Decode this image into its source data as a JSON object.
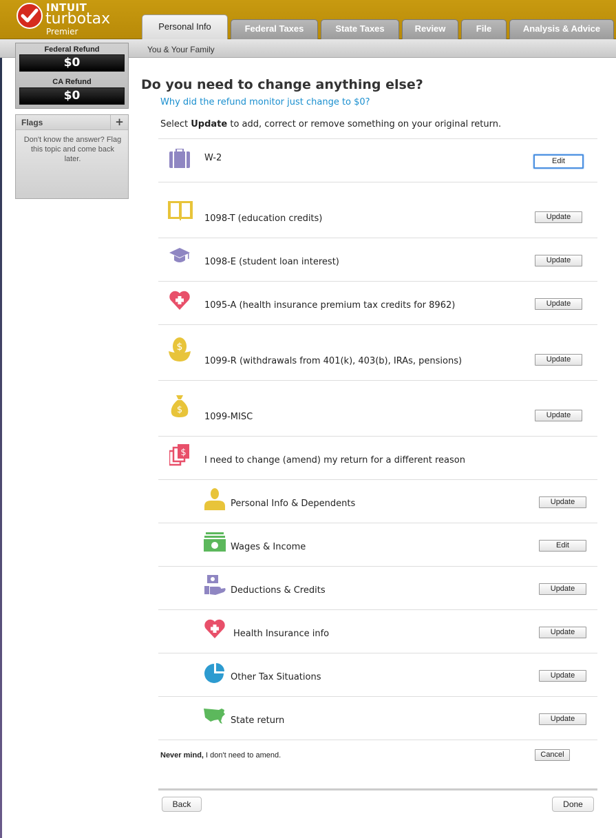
{
  "brand": {
    "company": "INTUIT",
    "product": "turbotax",
    "edition": "Premier"
  },
  "tabs": [
    {
      "label": "Personal Info"
    },
    {
      "label": "Federal Taxes"
    },
    {
      "label": "State Taxes"
    },
    {
      "label": "Review"
    },
    {
      "label": "File"
    },
    {
      "label": "Analysis & Advice"
    }
  ],
  "subheader": "You & Your Family",
  "sidebar": {
    "federal_refund_label": "Federal Refund",
    "federal_refund_value": "$0",
    "state_refund_label": "CA Refund",
    "state_refund_value": "$0",
    "flags_title": "Flags",
    "flags_add": "+",
    "flags_text": "Don't know the answer? Flag this topic and come back later."
  },
  "main": {
    "title": "Do you need to change anything else?",
    "why_link": "Why did the refund monitor just change to $0?",
    "instructions_pre": "Select ",
    "instructions_bold": "Update",
    "instructions_post": " to add, correct or remove something on your original return."
  },
  "forms": [
    {
      "label": "W-2",
      "button": "Edit",
      "icon": "briefcase-icon"
    },
    {
      "label": "1098-T (education credits)",
      "button": "Update",
      "icon": "book-icon"
    },
    {
      "label": "1098-E (student loan interest)",
      "button": "Update",
      "icon": "graduation-cap-icon"
    },
    {
      "label": "1095-A (health insurance premium tax credits for 8962)",
      "button": "Update",
      "icon": "heart-plus-icon"
    },
    {
      "label": "1099-R (withdrawals from 401(k), 403(b), IRAs, pensions)",
      "button": "Update",
      "icon": "nest-egg-icon"
    },
    {
      "label": "1099-MISC",
      "button": "Update",
      "icon": "money-bag-icon"
    }
  ],
  "amend": {
    "label": "I need to change (amend) my return for a different reason",
    "icon": "documents-icon"
  },
  "categories": [
    {
      "label": "Personal Info & Dependents",
      "button": "Update",
      "icon": "person-icon"
    },
    {
      "label": "Wages & Income",
      "button": "Edit",
      "icon": "cash-icon"
    },
    {
      "label": "Deductions & Credits",
      "button": "Update",
      "icon": "hand-money-icon"
    },
    {
      "label": "Health Insurance info",
      "button": "Update",
      "icon": "heart-plus-icon"
    },
    {
      "label": "Other Tax Situations",
      "button": "Update",
      "icon": "pie-chart-icon"
    },
    {
      "label": "State return",
      "button": "Update",
      "icon": "us-map-icon"
    }
  ],
  "footer": {
    "nevermind_bold": "Never mind,",
    "nevermind_rest": " I don't need to amend.",
    "cancel": "Cancel",
    "back": "Back",
    "done": "Done"
  },
  "colors": {
    "header_gold": "#c89a10",
    "link_blue": "#1a8fcf",
    "focus_blue": "#4a8fe0"
  }
}
